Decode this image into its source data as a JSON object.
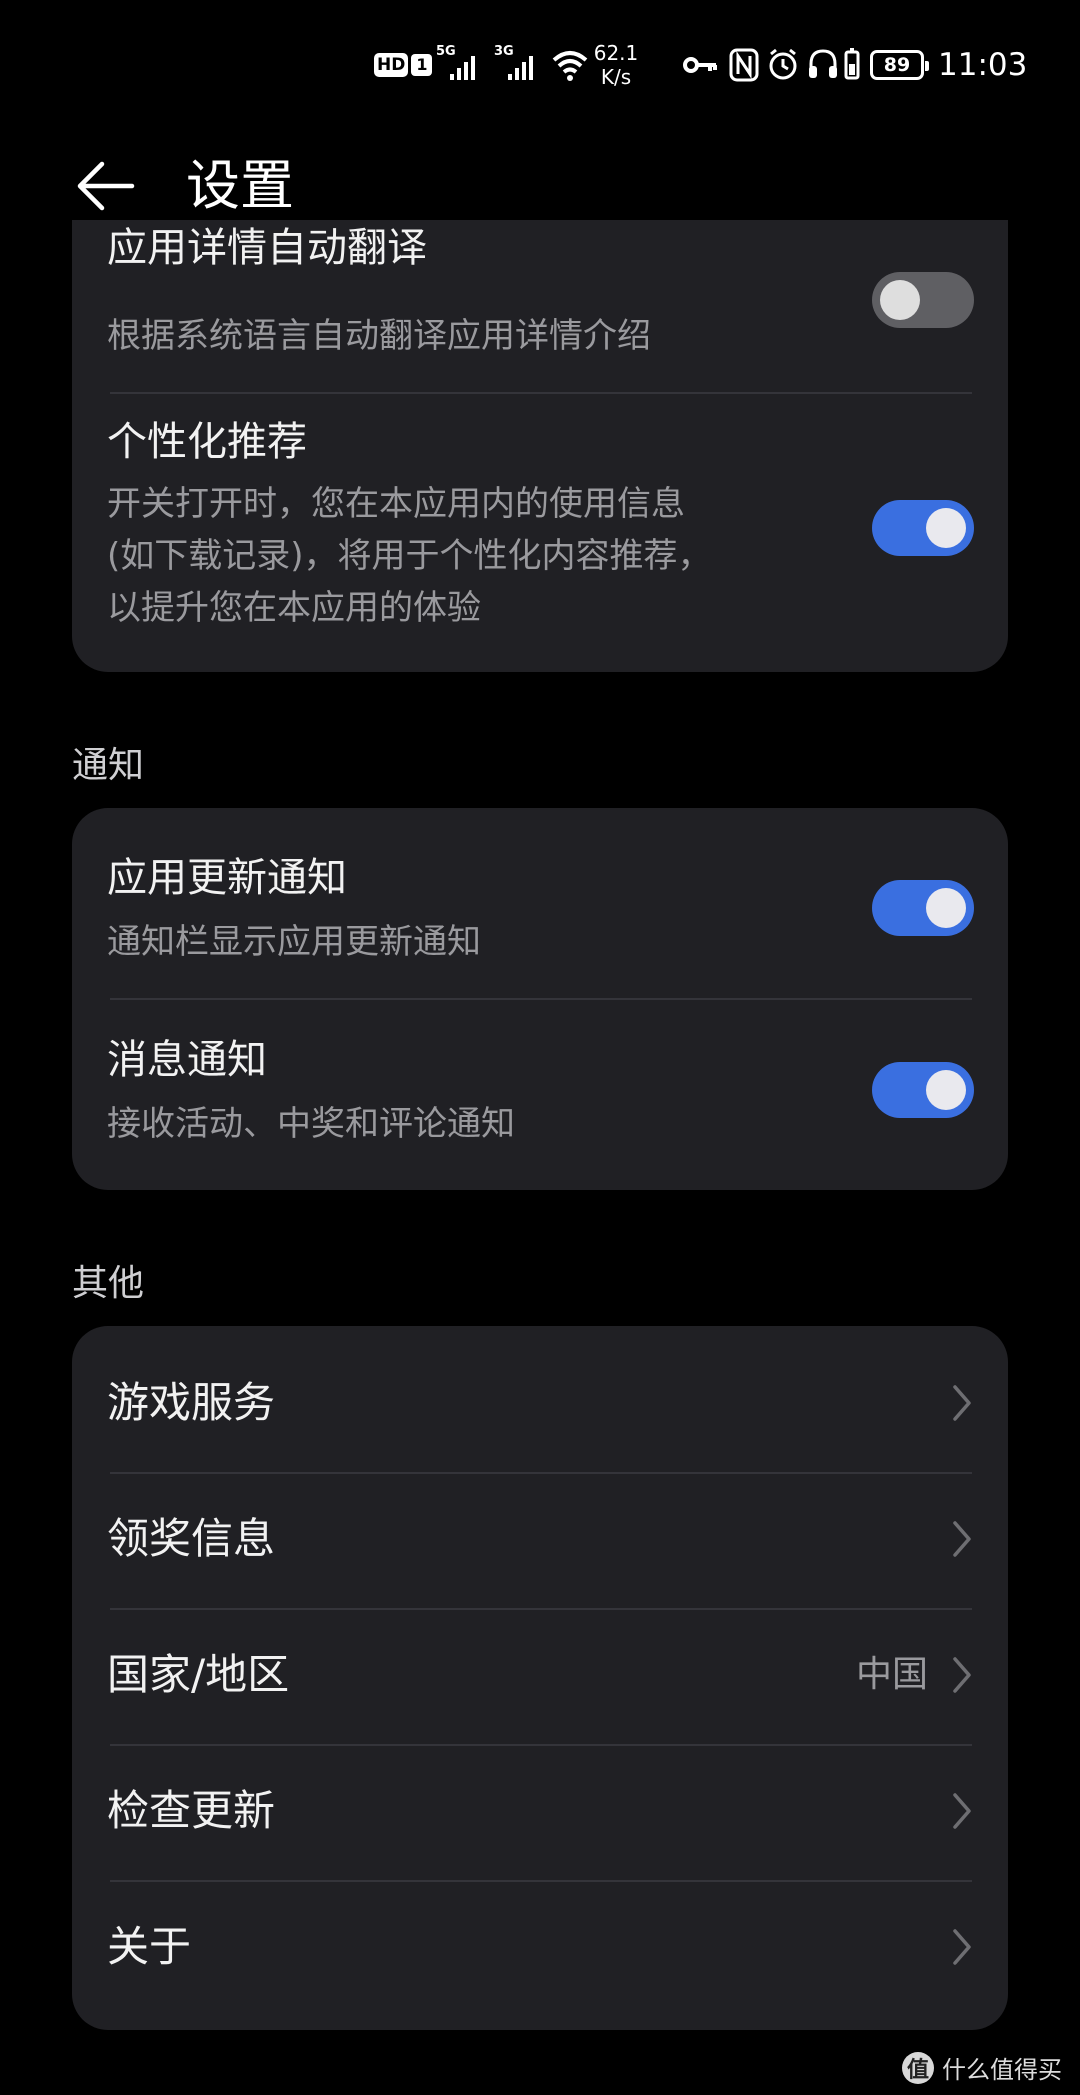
{
  "status_bar": {
    "hd": "HD",
    "sim": "1",
    "net1": "5G",
    "net2": "3G",
    "speed_value": "62.1",
    "speed_unit": "K/s",
    "battery": "89",
    "time": "11:03"
  },
  "header": {
    "title": "设置"
  },
  "settings_top": [
    {
      "title": "应用详情自动翻译",
      "desc_lines": [
        "根据系统语言自动翻译应用详情介绍"
      ],
      "toggle": "off"
    },
    {
      "title": "个性化推荐",
      "desc_lines": [
        "开关打开时，您在本应用内的使用信息",
        "(如下载记录)，将用于个性化内容推荐，",
        "以提升您在本应用的体验"
      ],
      "toggle": "on"
    }
  ],
  "notify_section": {
    "label": "通知",
    "items": [
      {
        "title": "应用更新通知",
        "desc": "通知栏显示应用更新通知",
        "toggle": "on"
      },
      {
        "title": "消息通知",
        "desc": "接收活动、中奖和评论通知",
        "toggle": "on"
      }
    ]
  },
  "other_section": {
    "label": "其他",
    "items": [
      {
        "label": "游戏服务",
        "value": ""
      },
      {
        "label": "领奖信息",
        "value": ""
      },
      {
        "label": "国家/地区",
        "value": "中国"
      },
      {
        "label": "检查更新",
        "value": ""
      },
      {
        "label": "关于",
        "value": ""
      }
    ]
  },
  "watermark": {
    "icon": "值",
    "text": "什么值得买"
  },
  "colors": {
    "background": "#000000",
    "card": "#202024",
    "accent": "#3a6fe0"
  }
}
